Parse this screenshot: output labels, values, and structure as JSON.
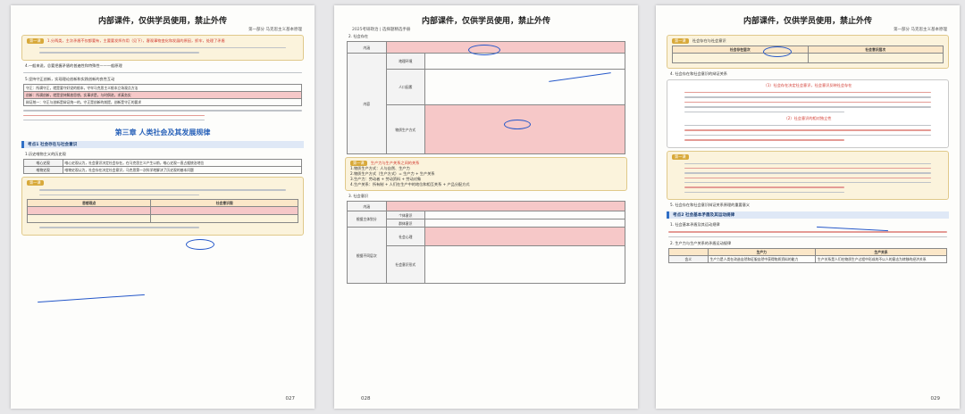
{
  "pages": [
    {
      "header_title": "内部课件，仅供学员使用，禁止外传",
      "header_sub": "第一部分  马克思主义基本原理",
      "box1_tag": "第一课",
      "box1_text": "1.分两类，主次矛盾不仅都要有，主要要发挥作用（见下），客观事物变化和发展的原因，抓牢，处理了矛盾",
      "section_a": "4.一般来说，总要把握矛盾的普遍性和特殊性——一般原理",
      "section_b": "5.坚持守正创新，实现理论创新和实践创新的良性互动",
      "table1_rows": [
        "守正：所谓守正，就是要守好党的根本，守牢马克思主义根本立场观点方法",
        "创新：所谓创新，就是坚持解放思想，实事求是，与时俱进，求真务实",
        "辩证统一：守正与创新是辩证统一的，守正是创新的前提，创新是守正的要求"
      ],
      "chapter_title": "第三章  人类社会及其发展规律",
      "kp_title": "考点1 社会存在与社会意识",
      "sub1": "1.历史唯物主义的历史观",
      "table2_left": [
        "唯心史观",
        "唯物史观"
      ],
      "table2_rows": [
        "唯心史观认为，社会意识决定社会存在。在马克思主义产生以前，唯心史观一直占据统治地位",
        "唯物史观认为，社会存在决定社会意识，马克思第一次科学地解决了历史观的基本问题"
      ],
      "box2_tag": "第一课",
      "table3_headers": [
        "思想观点",
        "社会意识观"
      ],
      "page_number": "027"
    },
    {
      "header_title": "内部课件，仅供学员使用，禁止外传",
      "header_sub": "2025考研政治 | 选择题精选手册",
      "section_title": "2. 社会存在",
      "row_labels": [
        "内涵",
        "内容"
      ],
      "sub_labels": [
        "地理环境",
        "人口因素",
        "物质生产方式"
      ],
      "box_tag": "第一课",
      "box_title": "生产力与生产关系之间的关系",
      "box_items": [
        "1.物质生产方式：人与自然、生产力",
        "2.物质生产方式（生产方式）= 生产力 + 生产关系",
        "3.生产力：劳动者 + 劳动资料 + 劳动对象",
        "4.生产关系：所有制 + 人们在生产中的地位和相互关系 + 产品分配方式"
      ],
      "section_title2": "3. 社会意识",
      "table2_labels": [
        "内涵",
        "根据主体划分",
        "根据不同层次"
      ],
      "sub2_labels": [
        "个体意识",
        "群体意识",
        "社会心理",
        "社会意识形式"
      ],
      "page_number": "028"
    },
    {
      "header_title": "内部课件，仅供学员使用，禁止外传",
      "header_sub": "第一部分  马克思主义基本原理",
      "box1_tag": "第一课",
      "box1_title": "社会存在与社会意识",
      "table_headers": [
        "社会存在层次",
        "社会意识层次"
      ],
      "section_a": "4. 社会存在和社会意识的辩证关系",
      "inner_title1": "（1）社会存在决定社会意识，社会意识反映社会存在",
      "inner_title2": "（2）社会意识的相对独立性",
      "box2_tag": "第一课",
      "section_b": "5. 社会存在和社会意识辩证关系原理的重要意义",
      "kp_title": "考点2 社会基本矛盾及其运动规律",
      "sub1": "1. 社会基本矛盾及其运动规律",
      "sub2": "2. 生产力与生产关系的矛盾运动规律",
      "table2_headers": [
        "生产力",
        "生产关系"
      ],
      "table2_label": "含义",
      "table2_cells": [
        "生产力是人类在改造自然和征服自然中获得物质资料的能力",
        "生产关系是人们在物质生产过程中形成的不以人的意志为转移的经济关系"
      ],
      "page_number": "029"
    }
  ],
  "colors": {
    "accent_blue": "#2962b9",
    "highlight_red": "#d1362c",
    "box_bg": "#fbf3dc",
    "ink": "#2457c9"
  }
}
